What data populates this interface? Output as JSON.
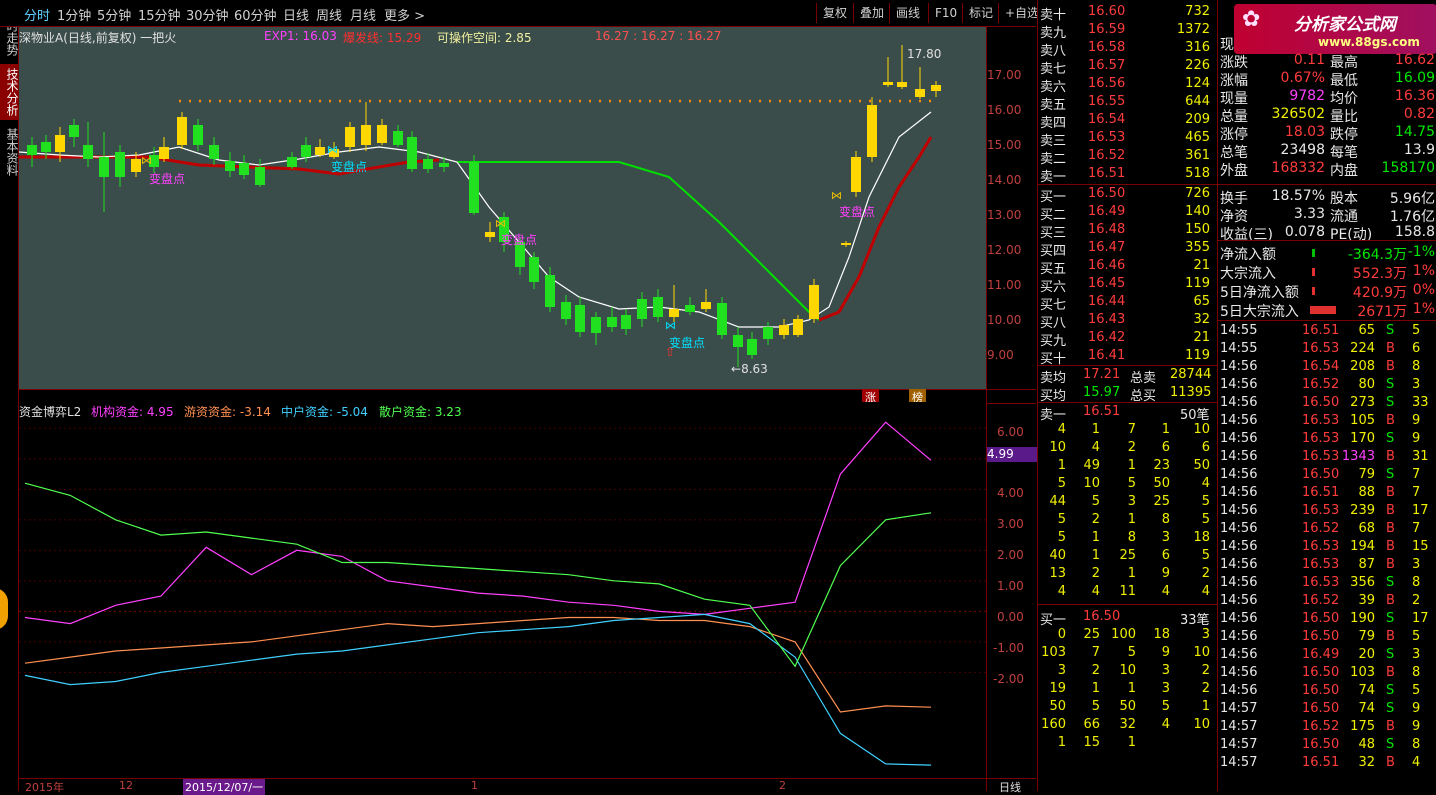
{
  "toolbar": {
    "periods": [
      "分时",
      "1分钟",
      "5分钟",
      "15分钟",
      "30分钟",
      "60分钟",
      "日线",
      "周线",
      "月线",
      "更多 >"
    ],
    "buttons": [
      "复权",
      "叠加",
      "画线",
      "F10",
      "标记",
      "+自选"
    ]
  },
  "left_tabs": [
    "分时走势",
    "技术分析",
    "基本资料"
  ],
  "main_chart": {
    "stock_title": "深物业A(日线,前复权) 一把火",
    "exp1_label": "EXP1: 16.03",
    "baofa_label": "爆发线: 15.29",
    "kecao_label": "可操作空间: 2.85",
    "ohlc_label": "16.27 : 16.27 : 16.27",
    "peak_label": "17.80",
    "trough_label": "8.63",
    "marker_label": "变盘点",
    "y_ticks": [
      "17.00",
      "16.00",
      "15.00",
      "14.00",
      "13.00",
      "12.00",
      "11.00",
      "10.00",
      "9.00"
    ],
    "bottom_tags": [
      "涨",
      "榜"
    ]
  },
  "sub_chart": {
    "title": "资金博弈L2",
    "inst_label": "机构资金: 4.95",
    "hot_label": "游资资金: -3.14",
    "mid_label": "中户资金: -5.04",
    "retail_label": "散户资金: 3.23",
    "y_ticks": [
      "6.00",
      "5.00",
      "4.00",
      "3.00",
      "2.00",
      "1.00",
      "0.00",
      "-1.00",
      "-2.00"
    ],
    "current_value": "4.99"
  },
  "bottom_axis": {
    "labels": [
      "2015年",
      "12",
      "2015/12/07/一",
      "1",
      "2"
    ],
    "period": "日线"
  },
  "chart_data": {
    "type": "line",
    "title": "资金博弈L2",
    "series": [
      {
        "name": "机构资金",
        "values": [
          -0.2,
          -0.4,
          0.2,
          0.5,
          2.1,
          1.2,
          2.0,
          1.8,
          1.0,
          0.8,
          0.6,
          0.5,
          0.3,
          0.2,
          0.0,
          -0.1,
          0.1,
          0.3,
          4.5,
          6.2,
          4.95
        ]
      },
      {
        "name": "游资资金",
        "values": [
          -1.7,
          -1.5,
          -1.3,
          -1.2,
          -1.1,
          -1.0,
          -0.8,
          -0.6,
          -0.4,
          -0.5,
          -0.4,
          -0.3,
          -0.2,
          -0.2,
          -0.3,
          -0.3,
          -0.5,
          -1.0,
          -3.3,
          -3.1,
          -3.14
        ]
      },
      {
        "name": "中户资金",
        "values": [
          -2.1,
          -2.4,
          -2.3,
          -2.0,
          -1.8,
          -1.6,
          -1.4,
          -1.3,
          -1.1,
          -0.9,
          -0.7,
          -0.6,
          -0.5,
          -0.3,
          -0.2,
          -0.1,
          -0.4,
          -1.5,
          -4.0,
          -5.0,
          -5.04
        ]
      },
      {
        "name": "散户资金",
        "values": [
          4.2,
          3.8,
          3.0,
          2.5,
          2.6,
          2.4,
          2.2,
          1.6,
          1.6,
          1.5,
          1.4,
          1.3,
          1.2,
          1.0,
          0.9,
          0.4,
          0.2,
          -1.8,
          1.5,
          3.0,
          3.23
        ]
      }
    ],
    "ylim": [
      -5.2,
      6.6
    ]
  },
  "order_book": {
    "sells": [
      {
        "label": "卖十",
        "price": "16.60",
        "vol": "732"
      },
      {
        "label": "卖九",
        "price": "16.59",
        "vol": "1372"
      },
      {
        "label": "卖八",
        "price": "16.58",
        "vol": "316"
      },
      {
        "label": "卖七",
        "price": "16.57",
        "vol": "226"
      },
      {
        "label": "卖六",
        "price": "16.56",
        "vol": "124"
      },
      {
        "label": "卖五",
        "price": "16.55",
        "vol": "644"
      },
      {
        "label": "卖四",
        "price": "16.54",
        "vol": "209"
      },
      {
        "label": "卖三",
        "price": "16.53",
        "vol": "465"
      },
      {
        "label": "卖二",
        "price": "16.52",
        "vol": "361"
      },
      {
        "label": "卖一",
        "price": "16.51",
        "vol": "518"
      }
    ],
    "buys": [
      {
        "label": "买一",
        "price": "16.50",
        "vol": "726"
      },
      {
        "label": "买二",
        "price": "16.49",
        "vol": "140"
      },
      {
        "label": "买三",
        "price": "16.48",
        "vol": "150"
      },
      {
        "label": "买四",
        "price": "16.47",
        "vol": "355"
      },
      {
        "label": "买五",
        "price": "16.46",
        "vol": "21"
      },
      {
        "label": "买六",
        "price": "16.45",
        "vol": "119"
      },
      {
        "label": "买七",
        "price": "16.44",
        "vol": "65"
      },
      {
        "label": "买八",
        "price": "16.43",
        "vol": "32"
      },
      {
        "label": "买九",
        "price": "16.42",
        "vol": "21"
      },
      {
        "label": "买十",
        "price": "16.41",
        "vol": "119"
      }
    ],
    "sell_avg_label": "卖均",
    "sell_avg": "17.21",
    "sell_total_label": "总卖",
    "sell_total": "28744",
    "buy_avg_label": "买均",
    "buy_avg": "15.97",
    "buy_total_label": "总买",
    "buy_total": "11395",
    "sell1_queue_title": "卖一",
    "sell1_queue_price": "16.51",
    "sell1_queue_count": "50笔",
    "sell1_queue": [
      [
        "4",
        "1",
        "7",
        "1",
        "10"
      ],
      [
        "10",
        "4",
        "2",
        "6",
        "6"
      ],
      [
        "1",
        "49",
        "1",
        "23",
        "50"
      ],
      [
        "5",
        "10",
        "5",
        "50",
        "4"
      ],
      [
        "44",
        "5",
        "3",
        "25",
        "5"
      ],
      [
        "5",
        "2",
        "1",
        "8",
        "5"
      ],
      [
        "5",
        "1",
        "8",
        "3",
        "18"
      ],
      [
        "40",
        "1",
        "25",
        "6",
        "5"
      ],
      [
        "13",
        "2",
        "1",
        "9",
        "2"
      ],
      [
        "4",
        "4",
        "11",
        "4",
        "4"
      ]
    ],
    "buy1_queue_title": "买一",
    "buy1_queue_price": "16.50",
    "buy1_queue_count": "33笔",
    "buy1_queue": [
      [
        "0",
        "25",
        "100",
        "18",
        "3"
      ],
      [
        "103",
        "7",
        "5",
        "9",
        "10"
      ],
      [
        "3",
        "2",
        "10",
        "3",
        "2"
      ],
      [
        "19",
        "1",
        "1",
        "3",
        "2"
      ],
      [
        "50",
        "5",
        "50",
        "5",
        "1"
      ],
      [
        "160",
        "66",
        "32",
        "4",
        "10"
      ],
      [
        "1",
        "15",
        "1",
        "",
        ""
      ]
    ]
  },
  "logo": {
    "text": "分析家公式网",
    "url_text": "www.88gs.com"
  },
  "info": {
    "rows": [
      {
        "l1": "现",
        "v1": "",
        "l2": "",
        "v2": ""
      },
      {
        "l1": "涨跌",
        "v1": "0.11",
        "l2": "最高",
        "v2": "16.62"
      },
      {
        "l1": "涨幅",
        "v1": "0.67%",
        "l2": "最低",
        "v2": "16.09"
      },
      {
        "l1": "现量",
        "v1": "9782",
        "l2": "均价",
        "v2": "16.36"
      },
      {
        "l1": "总量",
        "v1": "326502",
        "l2": "量比",
        "v2": "0.82"
      },
      {
        "l1": "涨停",
        "v1": "18.03",
        "l2": "跌停",
        "v2": "14.75"
      },
      {
        "l1": "总笔",
        "v1": "23498",
        "l2": "每笔",
        "v2": "13.9"
      },
      {
        "l1": "外盘",
        "v1": "168332",
        "l2": "内盘",
        "v2": "158170"
      },
      {
        "l1": "换手",
        "v1": "18.57%",
        "l2": "股本",
        "v2": "5.96亿"
      },
      {
        "l1": "净资",
        "v1": "3.33",
        "l2": "流通",
        "v2": "1.76亿"
      },
      {
        "l1": "收益(三)",
        "v1": "0.078",
        "l2": "PE(动)",
        "v2": "158.8"
      }
    ],
    "flows": [
      {
        "label": "净流入额",
        "value": "-364.3万",
        "pct": "-1%"
      },
      {
        "label": "大宗流入",
        "value": "552.3万",
        "pct": "1%"
      },
      {
        "label": "5日净流入额",
        "value": "420.9万",
        "pct": "0%"
      },
      {
        "label": "5日大宗流入",
        "value": "2671万",
        "pct": "1%"
      }
    ],
    "ticks": [
      [
        "14:55",
        "16.51",
        "65",
        "S"
      ],
      [
        "14:55",
        "16.53",
        "224",
        "B"
      ],
      [
        "14:56",
        "16.54",
        "208",
        "B"
      ],
      [
        "14:56",
        "16.52",
        "80",
        "S"
      ],
      [
        "14:56",
        "16.50",
        "273",
        "S"
      ],
      [
        "14:56",
        "16.53",
        "105",
        "B"
      ],
      [
        "14:56",
        "16.53",
        "170",
        "S"
      ],
      [
        "14:56",
        "16.53",
        "1343",
        "B"
      ],
      [
        "14:56",
        "16.50",
        "79",
        "S"
      ],
      [
        "14:56",
        "16.51",
        "88",
        "B"
      ],
      [
        "14:56",
        "16.53",
        "239",
        "B"
      ],
      [
        "14:56",
        "16.52",
        "68",
        "B"
      ],
      [
        "14:56",
        "16.53",
        "194",
        "B"
      ],
      [
        "14:56",
        "16.53",
        "87",
        "B"
      ],
      [
        "14:56",
        "16.53",
        "356",
        "S"
      ],
      [
        "14:56",
        "16.52",
        "39",
        "B"
      ],
      [
        "14:56",
        "16.50",
        "190",
        "S"
      ],
      [
        "14:56",
        "16.50",
        "79",
        "B"
      ],
      [
        "14:56",
        "16.49",
        "20",
        "S"
      ],
      [
        "14:56",
        "16.50",
        "103",
        "B"
      ],
      [
        "14:56",
        "16.50",
        "74",
        "S"
      ],
      [
        "14:57",
        "16.50",
        "74",
        "S"
      ],
      [
        "14:57",
        "16.52",
        "175",
        "B"
      ],
      [
        "14:57",
        "16.50",
        "48",
        "S"
      ],
      [
        "14:57",
        "16.51",
        "32",
        "B"
      ]
    ],
    "tick_extra": [
      "5",
      "6",
      "8",
      "3",
      "33",
      "9",
      "9",
      "31",
      "7",
      "7",
      "17",
      "7",
      "15",
      "3",
      "8",
      "2",
      "17",
      "5",
      "3",
      "8",
      "5",
      "9",
      "9",
      "8",
      "4"
    ]
  }
}
